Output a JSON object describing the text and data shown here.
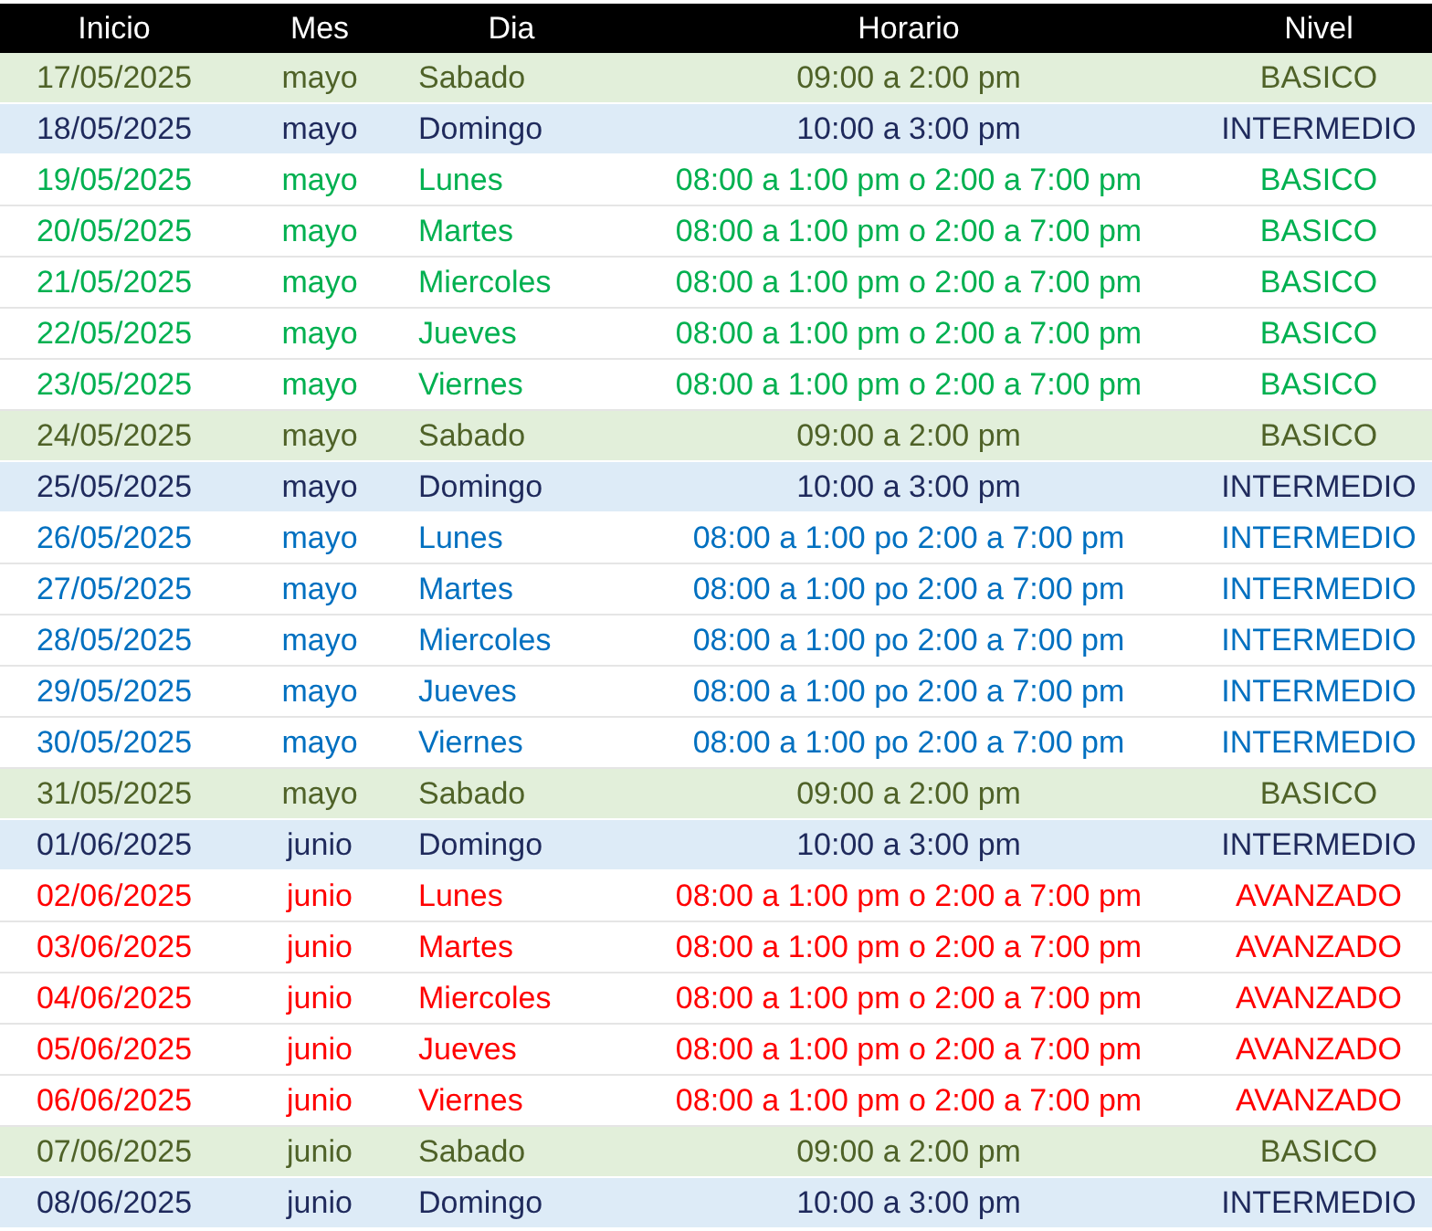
{
  "columns": [
    "Inicio",
    "Mes",
    "Dia",
    "Horario",
    "Nivel"
  ],
  "rows": [
    {
      "kind": "weekend",
      "color": "#4f6228",
      "cells": [
        "17/05/2025",
        "mayo",
        "Sabado",
        "09:00 a 2:00 pm",
        "BASICO"
      ]
    },
    {
      "kind": "holiday",
      "color": "#1f2a5c",
      "cells": [
        "18/05/2025",
        "mayo",
        "Domingo",
        "10:00 a 3:00 pm",
        "INTERMEDIO"
      ]
    },
    {
      "kind": "weekday",
      "color": "#00b050",
      "cells": [
        "19/05/2025",
        "mayo",
        "Lunes",
        "08:00 a 1:00 pm o 2:00 a 7:00 pm",
        "BASICO"
      ]
    },
    {
      "kind": "weekday",
      "color": "#00b050",
      "cells": [
        "20/05/2025",
        "mayo",
        "Martes",
        "08:00 a 1:00 pm o 2:00 a 7:00 pm",
        "BASICO"
      ]
    },
    {
      "kind": "weekday",
      "color": "#00b050",
      "cells": [
        "21/05/2025",
        "mayo",
        "Miercoles",
        "08:00 a 1:00 pm o 2:00 a 7:00 pm",
        "BASICO"
      ]
    },
    {
      "kind": "weekday",
      "color": "#00b050",
      "cells": [
        "22/05/2025",
        "mayo",
        "Jueves",
        "08:00 a 1:00 pm o 2:00 a 7:00 pm",
        "BASICO"
      ]
    },
    {
      "kind": "weekday",
      "color": "#00b050",
      "cells": [
        "23/05/2025",
        "mayo",
        "Viernes",
        "08:00 a 1:00 pm o 2:00 a 7:00 pm",
        "BASICO"
      ]
    },
    {
      "kind": "weekend",
      "color": "#4f6228",
      "cells": [
        "24/05/2025",
        "mayo",
        "Sabado",
        "09:00 a 2:00 pm",
        "BASICO"
      ]
    },
    {
      "kind": "holiday",
      "color": "#1f2a5c",
      "cells": [
        "25/05/2025",
        "mayo",
        "Domingo",
        "10:00 a 3:00 pm",
        "INTERMEDIO"
      ]
    },
    {
      "kind": "weekday",
      "color": "#0070c0",
      "cells": [
        "26/05/2025",
        "mayo",
        "Lunes",
        "08:00 a 1:00 po 2:00 a 7:00 pm",
        "INTERMEDIO"
      ]
    },
    {
      "kind": "weekday",
      "color": "#0070c0",
      "cells": [
        "27/05/2025",
        "mayo",
        "Martes",
        "08:00 a 1:00 po 2:00 a 7:00 pm",
        "INTERMEDIO"
      ]
    },
    {
      "kind": "weekday",
      "color": "#0070c0",
      "cells": [
        "28/05/2025",
        "mayo",
        "Miercoles",
        "08:00 a 1:00 po 2:00 a 7:00 pm",
        "INTERMEDIO"
      ]
    },
    {
      "kind": "weekday",
      "color": "#0070c0",
      "cells": [
        "29/05/2025",
        "mayo",
        "Jueves",
        "08:00 a 1:00 po 2:00 a 7:00 pm",
        "INTERMEDIO"
      ]
    },
    {
      "kind": "weekday",
      "color": "#0070c0",
      "cells": [
        "30/05/2025",
        "mayo",
        "Viernes",
        "08:00 a 1:00 po 2:00 a 7:00 pm",
        "INTERMEDIO"
      ]
    },
    {
      "kind": "weekend",
      "color": "#4f6228",
      "cells": [
        "31/05/2025",
        "mayo",
        "Sabado",
        "09:00 a 2:00 pm",
        "BASICO"
      ]
    },
    {
      "kind": "holiday",
      "color": "#1f2a5c",
      "cells": [
        "01/06/2025",
        "junio",
        "Domingo",
        "10:00 a 3:00 pm",
        "INTERMEDIO"
      ]
    },
    {
      "kind": "weekday",
      "color": "#ff0000",
      "cells": [
        "02/06/2025",
        "junio",
        "Lunes",
        "08:00 a 1:00 pm o 2:00 a 7:00 pm",
        "AVANZADO"
      ]
    },
    {
      "kind": "weekday",
      "color": "#ff0000",
      "cells": [
        "03/06/2025",
        "junio",
        "Martes",
        "08:00 a 1:00 pm o 2:00 a 7:00 pm",
        "AVANZADO"
      ]
    },
    {
      "kind": "weekday",
      "color": "#ff0000",
      "cells": [
        "04/06/2025",
        "junio",
        "Miercoles",
        "08:00 a 1:00 pm o 2:00 a 7:00 pm",
        "AVANZADO"
      ]
    },
    {
      "kind": "weekday",
      "color": "#ff0000",
      "cells": [
        "05/06/2025",
        "junio",
        "Jueves",
        "08:00 a 1:00 pm o 2:00 a 7:00 pm",
        "AVANZADO"
      ]
    },
    {
      "kind": "weekday",
      "color": "#ff0000",
      "cells": [
        "06/06/2025",
        "junio",
        "Viernes",
        "08:00 a 1:00 pm o 2:00 a 7:00 pm",
        "AVANZADO"
      ]
    },
    {
      "kind": "weekend",
      "color": "#4f6228",
      "cells": [
        "07/06/2025",
        "junio",
        "Sabado",
        "09:00 a 2:00 pm",
        "BASICO"
      ]
    },
    {
      "kind": "holiday",
      "color": "#1f2a5c",
      "cells": [
        "08/06/2025",
        "junio",
        "Domingo",
        "10:00 a 3:00 pm",
        "INTERMEDIO"
      ]
    }
  ]
}
